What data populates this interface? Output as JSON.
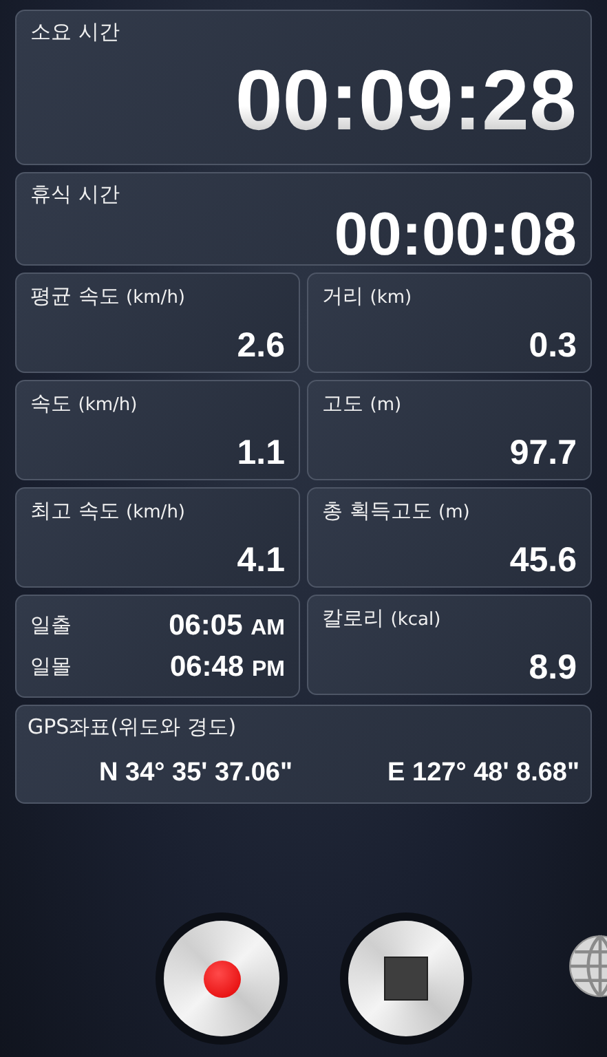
{
  "timers": [
    {
      "label": "소요 시간",
      "value": "00:09:28",
      "kind": "big"
    },
    {
      "label": "휴식 시간",
      "value": "00:00:08",
      "kind": "medium"
    }
  ],
  "cards": [
    {
      "kind": "metric",
      "label": "평균 속도",
      "unit": "(km/h)",
      "value": "2.6"
    },
    {
      "kind": "metric",
      "label": "거리",
      "unit": "(km)",
      "value": "0.3"
    },
    {
      "kind": "metric",
      "label": "속도",
      "unit": "(km/h)",
      "value": "1.1"
    },
    {
      "kind": "metric",
      "label": "고도",
      "unit": "(m)",
      "value": "97.7"
    },
    {
      "kind": "metric",
      "label": "최고 속도",
      "unit": "(km/h)",
      "value": "4.1"
    },
    {
      "kind": "metric",
      "label": "총 획득고도",
      "unit": "(m)",
      "value": "45.6"
    },
    {
      "kind": "sun",
      "rows": [
        {
          "label": "일출",
          "time": "06:05",
          "ampm": "AM"
        },
        {
          "label": "일몰",
          "time": "06:48",
          "ampm": "PM"
        }
      ]
    },
    {
      "kind": "metric",
      "label": "칼로리",
      "unit": "(kcal)",
      "value": "8.9"
    }
  ],
  "gps": {
    "label": "GPS좌표(위도와 경도)",
    "latitude": "N 34° 35' 37.06\"",
    "longitude": "E 127° 48' 8.68\""
  },
  "buttons": [
    {
      "kind": "record"
    },
    {
      "kind": "stop"
    },
    {
      "kind": "globe"
    }
  ]
}
